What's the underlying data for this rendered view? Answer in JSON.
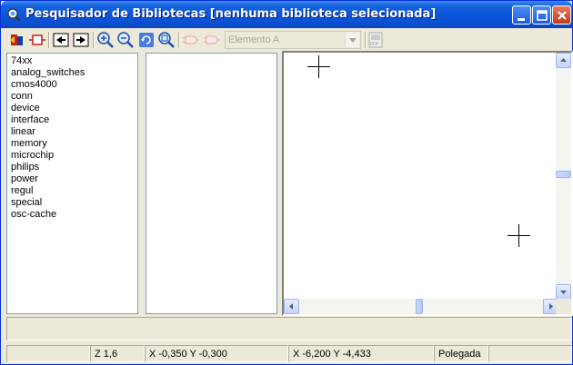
{
  "window": {
    "title": "Pesquisador de Bibliotecas [nenhuma biblioteca selecionada]"
  },
  "toolbar": {
    "icons": [
      "open-library-icon",
      "close-library-icon",
      "previous-icon",
      "next-icon",
      "zoom-in-icon",
      "zoom-out-icon",
      "refresh-icon",
      "zoom-fit-icon",
      "pin-a-icon",
      "pin-b-icon",
      "pdf-icon"
    ],
    "element_select": "Elemento A"
  },
  "libraries": [
    "74xx",
    "analog_switches",
    "cmos4000",
    "conn",
    "device",
    "interface",
    "linear",
    "memory",
    "microchip",
    "philips",
    "power",
    "regul",
    "special",
    "osc-cache"
  ],
  "status": {
    "zoom": "Z 1,6",
    "cursor": "X -0,350  Y -0,300",
    "position": "X -6,200  Y -4,433",
    "units": "Polegada"
  }
}
